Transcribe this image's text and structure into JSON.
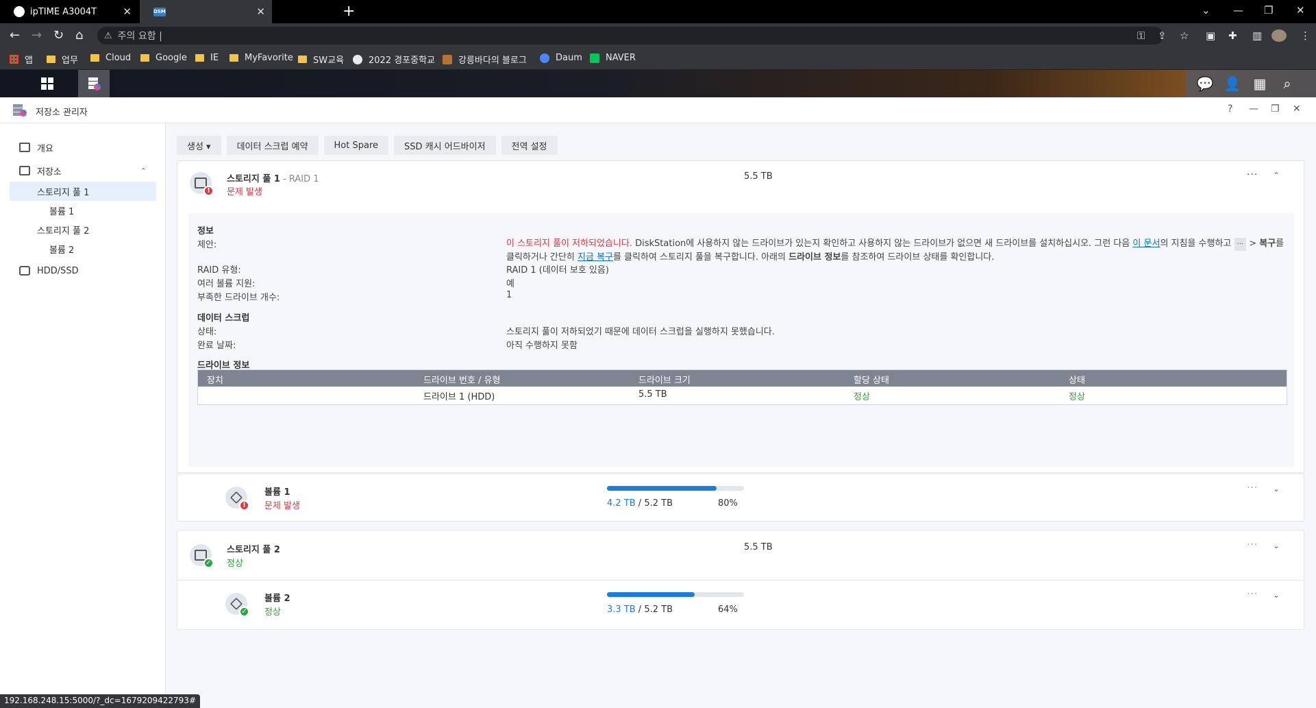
{
  "browser": {
    "tabs": [
      {
        "title": "ipTIME A3004T",
        "active": false
      },
      {
        "title": "",
        "active": true
      }
    ],
    "tab_close": "✕",
    "new_tab": "+",
    "window_controls": [
      "⌄",
      "—",
      "❐",
      "✕"
    ],
    "address": "주의 요함 |",
    "bookmarks": [
      {
        "label": "앱",
        "icon": "apps-grid-icon"
      },
      {
        "label": "업무",
        "icon": "folder-icon"
      },
      {
        "label": "Cloud",
        "icon": "folder-icon"
      },
      {
        "label": "Google",
        "icon": "folder-icon"
      },
      {
        "label": "IE",
        "icon": "folder-icon"
      },
      {
        "label": "MyFavorite",
        "icon": "folder-icon"
      },
      {
        "label": "SW교육",
        "icon": "folder-icon"
      },
      {
        "label": "2022 경포중학교",
        "icon": "globe-icon"
      },
      {
        "label": "강릉바다의 블로그",
        "icon": "blog-icon"
      },
      {
        "label": "Daum",
        "icon": "daum-icon"
      },
      {
        "label": "NAVER",
        "icon": "naver-icon"
      }
    ],
    "status_url": "192.168.248.15:5000/?_dc=1679209422793#"
  },
  "app": {
    "title": "저장소 관리자",
    "window_buttons": [
      "?",
      "—",
      "❐",
      "✕"
    ]
  },
  "sidebar": {
    "items": [
      {
        "label": "개요"
      },
      {
        "label": "저장소"
      },
      {
        "label": "스토리지 풀 1"
      },
      {
        "label": "볼륨 1"
      },
      {
        "label": "스토리지 풀 2"
      },
      {
        "label": "볼륨 2"
      },
      {
        "label": "HDD/SSD"
      }
    ]
  },
  "actions": [
    "생성 ▾",
    "데이터 스크럽 예약",
    "Hot Spare",
    "SSD 캐시 어드바이저",
    "전역 설정"
  ],
  "pool1": {
    "title": "스토리지 풀 1",
    "raid": " - RAID 1",
    "status": "문제 발생",
    "size": "5.5 TB",
    "details": {
      "info_heading": "정보",
      "suggestion_label": "제안:",
      "suggestion_line1_red": "이 스토리지 풀이 저하되었습니다.",
      "suggestion_line1_rest": " DiskStation에 사용하지 않는 드라이브가 있는지 확인하고 사용하지 않는 드라이브가 없으면 새 드라이브를 설치하십시오. 그런 다음 ",
      "suggestion_link1": "이 문서",
      "suggestion_line2_a": "의 지침을 수행하고 ",
      "suggestion_kbd": "···",
      "suggestion_line2_b": " > ",
      "suggestion_bold1": "복구",
      "suggestion_line2_c": "를 클릭하거나 간단히 ",
      "suggestion_link2": "지금 복구",
      "suggestion_line2_d": "를 클릭하여 스토리지 풀을 복구합니다. 아래의 ",
      "suggestion_bold2": "드라이브 정보",
      "suggestion_line2_e": "를 참조하여 드라이브 상태를 확인합니다.",
      "raid_type_label": "RAID 유형:",
      "raid_type_value": "RAID 1 (데이터 보호 있음)",
      "multi_vol_label": "여러 볼륨 지원:",
      "multi_vol_value": "예",
      "missing_label": "부족한 드라이브 개수:",
      "missing_value": "1",
      "scrub_heading": "데이터 스크럽",
      "scrub_status_label": "상태:",
      "scrub_status_value": "스토리지 풀이 저하되었기 때문에 데이터 스크럽을 실행하지 못했습니다.",
      "scrub_done_label": "완료 날짜:",
      "scrub_done_value": "아직 수행하지 못함",
      "drive_heading": "드라이브 정보",
      "table_headers": [
        "장치",
        "드라이브 번호 / 유형",
        "드라이브 크기",
        "할당 상태",
        "상태"
      ],
      "table_rows": [
        [
          "",
          "드라이브 1 (HDD)",
          "5.5 TB",
          "정상",
          "정상"
        ]
      ]
    }
  },
  "volume1": {
    "title": "볼륨 1",
    "status": "문제 발생",
    "used": "4.2 TB",
    "total": " / 5.2 TB",
    "percent": "80%",
    "fill": 0.8
  },
  "pool2": {
    "title": "스토리지 풀 2",
    "status": "정상",
    "size": "5.5 TB"
  },
  "volume2": {
    "title": "볼륨 2",
    "status": "정상",
    "used": "3.3 TB",
    "total": " / 5.2 TB",
    "percent": "64%",
    "fill": 0.64
  },
  "glyphs": {
    "more": "···",
    "chev_up": "⌃",
    "chev_down": "⌄",
    "err": "!",
    "ok": "✓"
  },
  "colors": {
    "error": "#e0373f",
    "ok": "#2aa234",
    "accent": "#1a7ee0"
  }
}
